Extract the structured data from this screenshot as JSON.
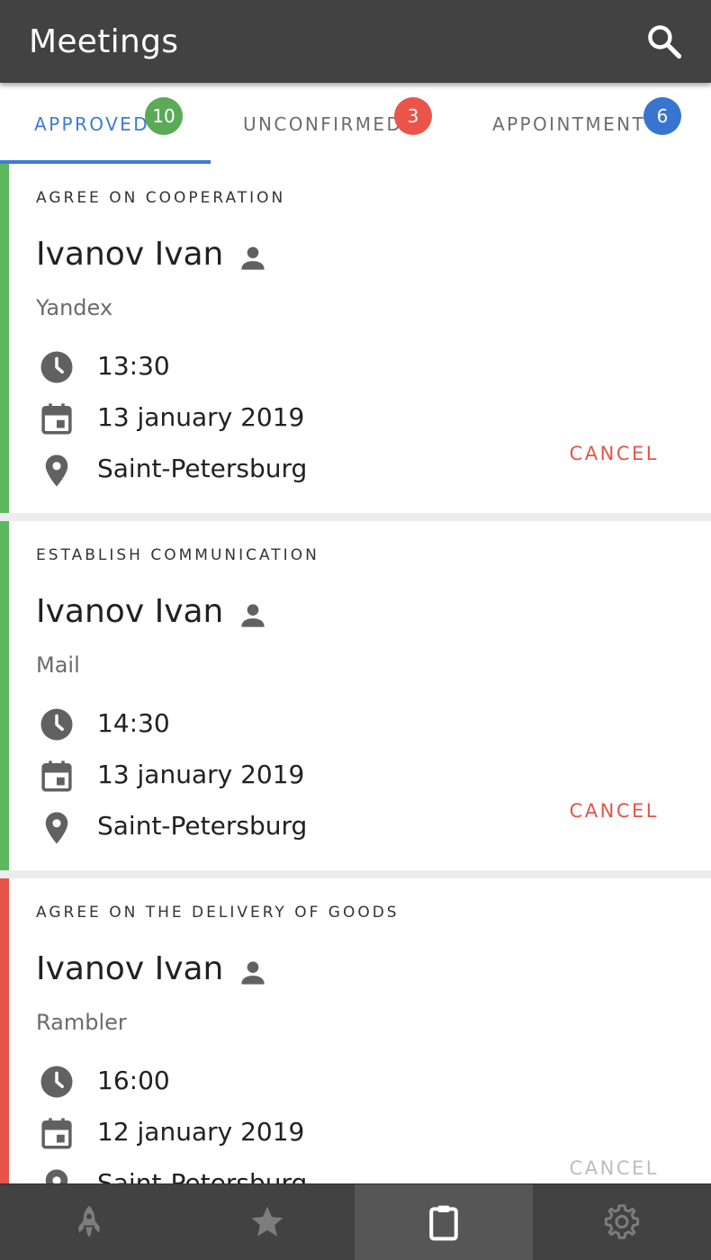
{
  "appbar": {
    "title": "Meetings",
    "search_icon": "search-icon"
  },
  "tabs": [
    {
      "label": "APPROVED",
      "badge": "10",
      "badge_color": "#5aaa58",
      "active": true
    },
    {
      "label": "UNCONFIRMED",
      "badge": "3",
      "badge_color": "#ea5449",
      "active": false
    },
    {
      "label": "APPOINTMENT",
      "badge": "6",
      "badge_color": "#3875cf",
      "active": false
    }
  ],
  "colors": {
    "accent": "#3d7bd6",
    "approved_stripe": "#5cb85c",
    "declined_stripe": "#e65447",
    "cancel": "#e65447",
    "appbar": "#424242"
  },
  "meetings": [
    {
      "topic": "AGREE ON COOPERATION",
      "name": "Ivanov Ivan",
      "company": "Yandex",
      "time": "13:30",
      "date": "13 january 2019",
      "place": "Saint-Petersburg",
      "action": "CANCEL",
      "stripe_color": "#5cb85c"
    },
    {
      "topic": "ESTABLISH COMMUNICATION",
      "name": "Ivanov Ivan",
      "company": "Mail",
      "time": "14:30",
      "date": "13 january 2019",
      "place": "Saint-Petersburg",
      "action": "CANCEL",
      "stripe_color": "#5cb85c"
    },
    {
      "topic": "AGREE ON THE DELIVERY OF GOODS",
      "name": "Ivanov Ivan",
      "company": "Rambler",
      "time": "16:00",
      "date": "12 january 2019",
      "place": "Saint-Petersburg",
      "action": "CANCEL",
      "stripe_color": "#e65447"
    }
  ],
  "bottom_nav": [
    {
      "icon": "rocket-icon",
      "active": false
    },
    {
      "icon": "star-icon",
      "active": false
    },
    {
      "icon": "clipboard-icon",
      "active": true
    },
    {
      "icon": "gear-icon",
      "active": false
    }
  ]
}
